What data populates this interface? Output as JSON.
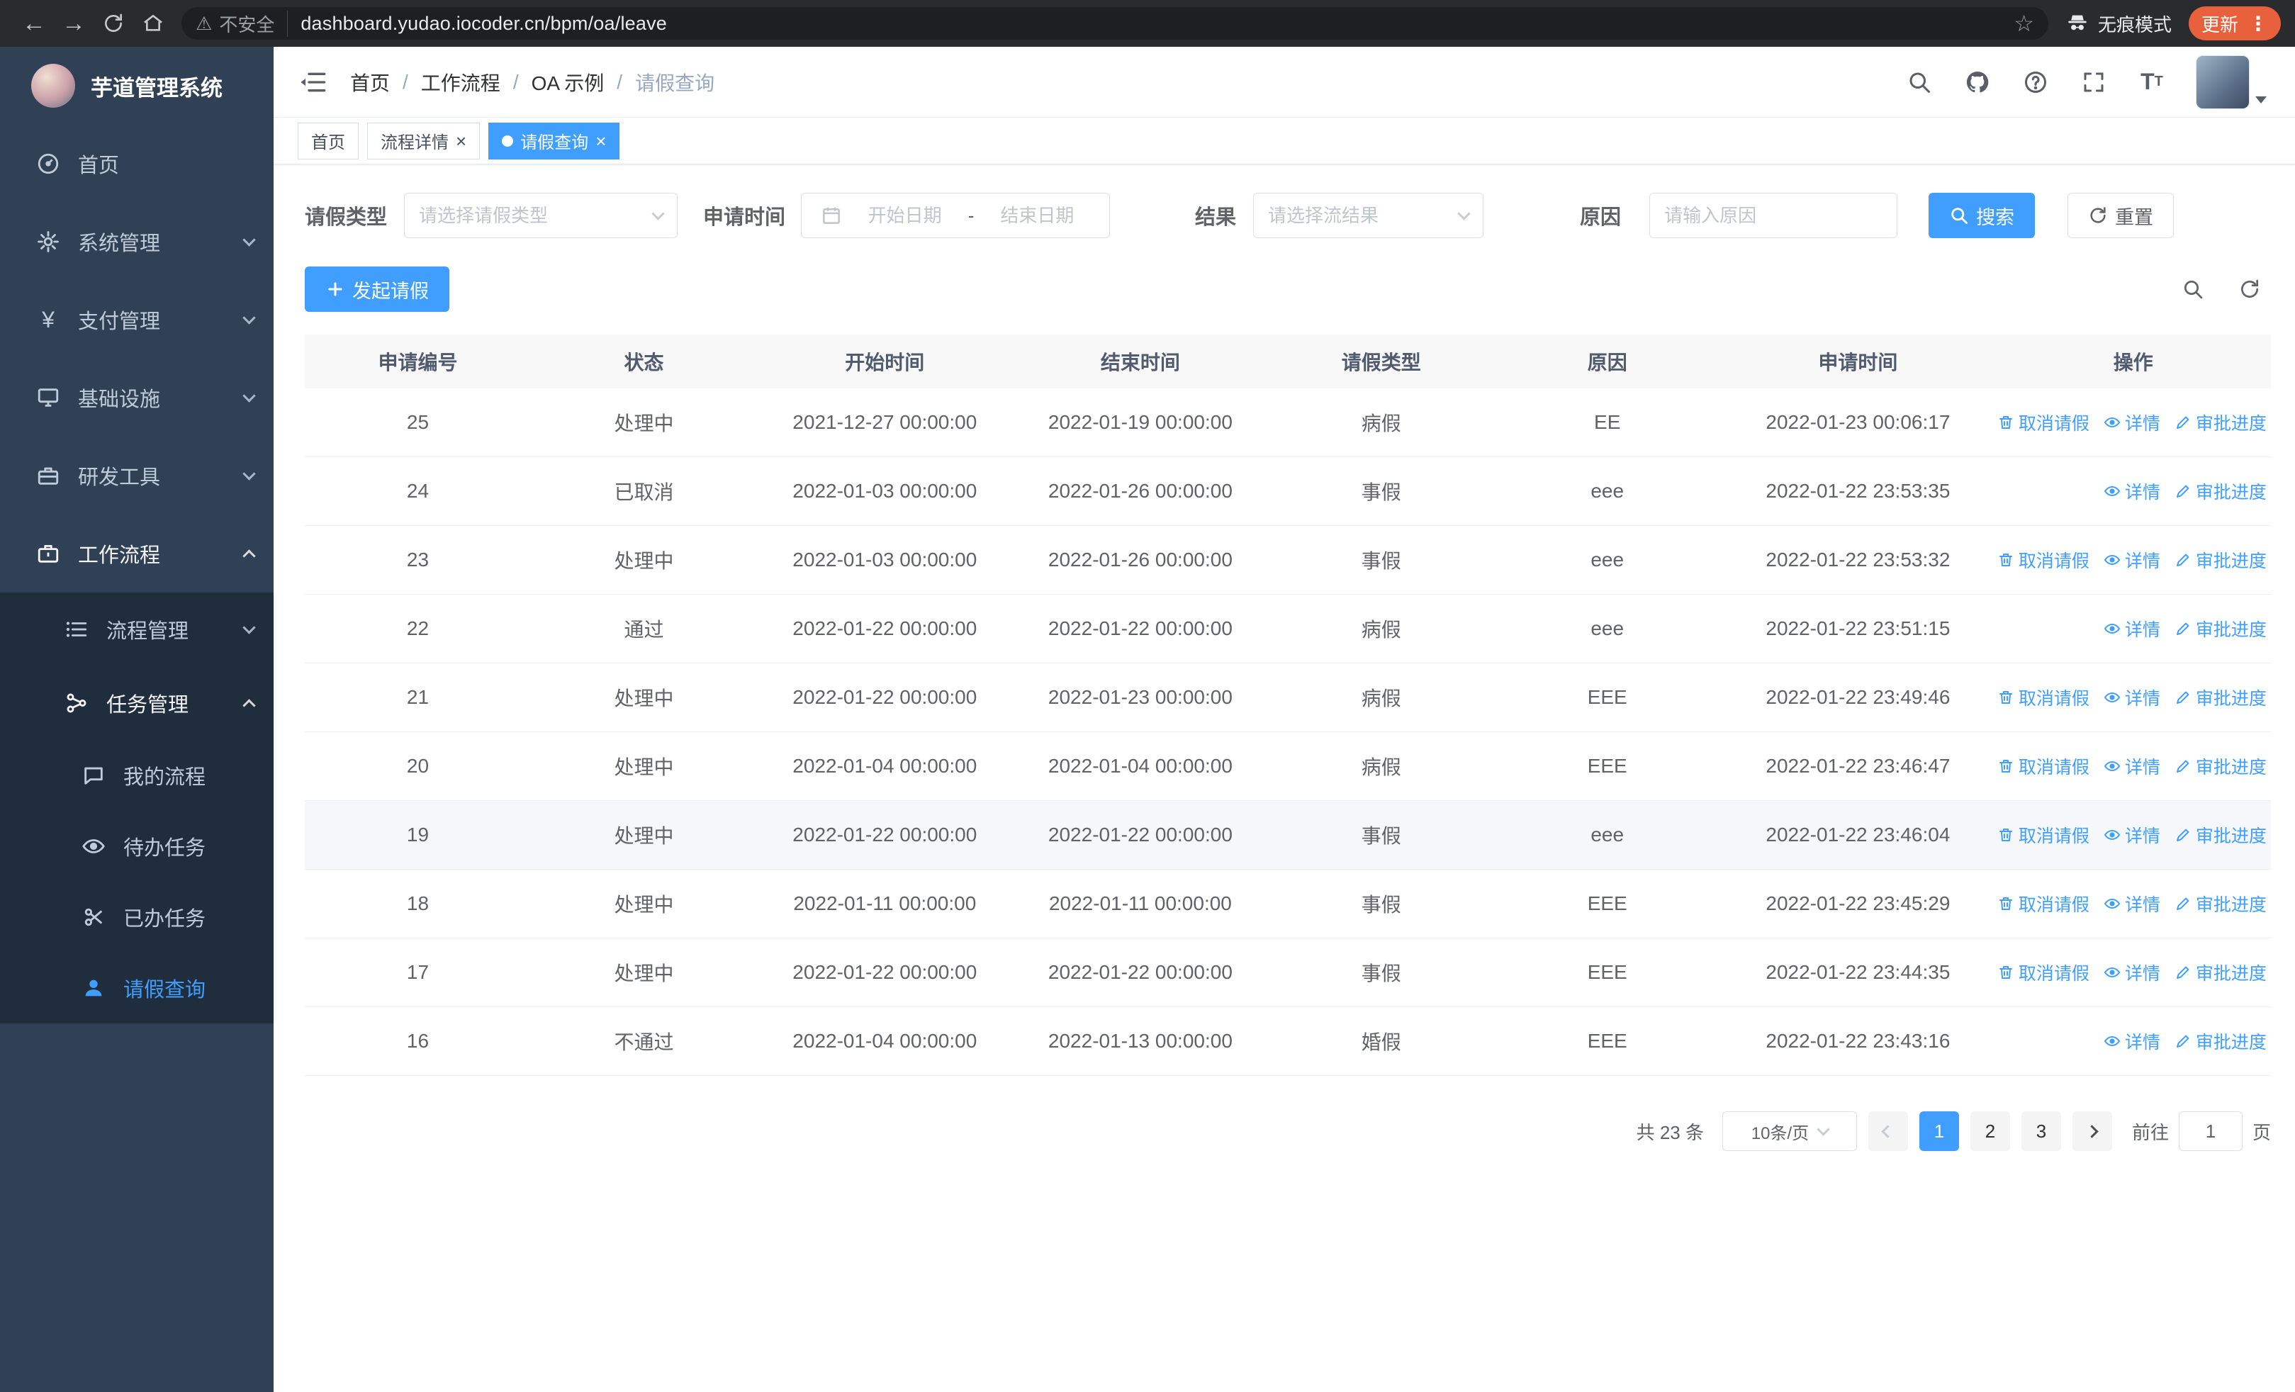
{
  "browser": {
    "security_label": "不安全",
    "url": "dashboard.yudao.iocoder.cn/bpm/oa/leave",
    "incognito_label": "无痕模式",
    "update_label": "更新"
  },
  "sidebar": {
    "logo_title": "芋道管理系统",
    "items": [
      {
        "label": "首页"
      },
      {
        "label": "系统管理"
      },
      {
        "label": "支付管理"
      },
      {
        "label": "基础设施"
      },
      {
        "label": "研发工具"
      },
      {
        "label": "工作流程"
      },
      {
        "label": "流程管理"
      },
      {
        "label": "任务管理"
      },
      {
        "label": "我的流程"
      },
      {
        "label": "待办任务"
      },
      {
        "label": "已办任务"
      },
      {
        "label": "请假查询"
      }
    ]
  },
  "header": {
    "breadcrumb": [
      "首页",
      "工作流程",
      "OA 示例",
      "请假查询"
    ],
    "separator": "/"
  },
  "tabs": {
    "close_glyph": "×",
    "items": [
      {
        "label": "首页"
      },
      {
        "label": "流程详情"
      },
      {
        "label": "请假查询"
      }
    ]
  },
  "filters": {
    "leave_type_label": "请假类型",
    "leave_type_placeholder": "请选择请假类型",
    "apply_time_label": "申请时间",
    "start_date_placeholder": "开始日期",
    "range_separator": "-",
    "end_date_placeholder": "结束日期",
    "result_label": "结果",
    "result_placeholder": "请选择流结果",
    "reason_label": "原因",
    "reason_placeholder": "请输入原因",
    "search_label": "搜索",
    "reset_label": "重置"
  },
  "toolbar": {
    "create_label": "发起请假"
  },
  "table": {
    "headers": [
      "申请编号",
      "状态",
      "开始时间",
      "结束时间",
      "请假类型",
      "原因",
      "申请时间",
      "操作"
    ],
    "action_defs": {
      "cancel": {
        "label": "取消请假",
        "name": "cancel-leave-link",
        "icon": "delete-icon"
      },
      "detail": {
        "label": "详情",
        "name": "detail-link",
        "icon": "eye-icon"
      },
      "progress": {
        "label": "审批进度",
        "name": "approval-progress-link",
        "icon": "edit-icon"
      }
    },
    "rows": [
      {
        "id": "25",
        "status": "处理中",
        "start": "2021-12-27 00:00:00",
        "end": "2022-01-19 00:00:00",
        "type": "病假",
        "reason": "EE",
        "applied": "2022-01-23 00:06:17",
        "actions": [
          "cancel",
          "detail",
          "progress"
        ],
        "highlighted": false
      },
      {
        "id": "24",
        "status": "已取消",
        "start": "2022-01-03 00:00:00",
        "end": "2022-01-26 00:00:00",
        "type": "事假",
        "reason": "eee",
        "applied": "2022-01-22 23:53:35",
        "actions": [
          "detail",
          "progress"
        ],
        "highlighted": false
      },
      {
        "id": "23",
        "status": "处理中",
        "start": "2022-01-03 00:00:00",
        "end": "2022-01-26 00:00:00",
        "type": "事假",
        "reason": "eee",
        "applied": "2022-01-22 23:53:32",
        "actions": [
          "cancel",
          "detail",
          "progress"
        ],
        "highlighted": false
      },
      {
        "id": "22",
        "status": "通过",
        "start": "2022-01-22 00:00:00",
        "end": "2022-01-22 00:00:00",
        "type": "病假",
        "reason": "eee",
        "applied": "2022-01-22 23:51:15",
        "actions": [
          "detail",
          "progress"
        ],
        "highlighted": false
      },
      {
        "id": "21",
        "status": "处理中",
        "start": "2022-01-22 00:00:00",
        "end": "2022-01-23 00:00:00",
        "type": "病假",
        "reason": "EEE",
        "applied": "2022-01-22 23:49:46",
        "actions": [
          "cancel",
          "detail",
          "progress"
        ],
        "highlighted": false
      },
      {
        "id": "20",
        "status": "处理中",
        "start": "2022-01-04 00:00:00",
        "end": "2022-01-04 00:00:00",
        "type": "病假",
        "reason": "EEE",
        "applied": "2022-01-22 23:46:47",
        "actions": [
          "cancel",
          "detail",
          "progress"
        ],
        "highlighted": false
      },
      {
        "id": "19",
        "status": "处理中",
        "start": "2022-01-22 00:00:00",
        "end": "2022-01-22 00:00:00",
        "type": "事假",
        "reason": "eee",
        "applied": "2022-01-22 23:46:04",
        "actions": [
          "cancel",
          "detail",
          "progress"
        ],
        "highlighted": true
      },
      {
        "id": "18",
        "status": "处理中",
        "start": "2022-01-11 00:00:00",
        "end": "2022-01-11 00:00:00",
        "type": "事假",
        "reason": "EEE",
        "applied": "2022-01-22 23:45:29",
        "actions": [
          "cancel",
          "detail",
          "progress"
        ],
        "highlighted": false
      },
      {
        "id": "17",
        "status": "处理中",
        "start": "2022-01-22 00:00:00",
        "end": "2022-01-22 00:00:00",
        "type": "事假",
        "reason": "EEE",
        "applied": "2022-01-22 23:44:35",
        "actions": [
          "cancel",
          "detail",
          "progress"
        ],
        "highlighted": false
      },
      {
        "id": "16",
        "status": "不通过",
        "start": "2022-01-04 00:00:00",
        "end": "2022-01-13 00:00:00",
        "type": "婚假",
        "reason": "EEE",
        "applied": "2022-01-22 23:43:16",
        "actions": [
          "detail",
          "progress"
        ],
        "highlighted": false
      }
    ]
  },
  "pagination": {
    "total_label": "共 23 条",
    "page_size": "10条/页",
    "pages": [
      "1",
      "2",
      "3"
    ],
    "active_page": "1",
    "goto_label": "前往",
    "goto_value": "1",
    "goto_suffix": "页"
  }
}
